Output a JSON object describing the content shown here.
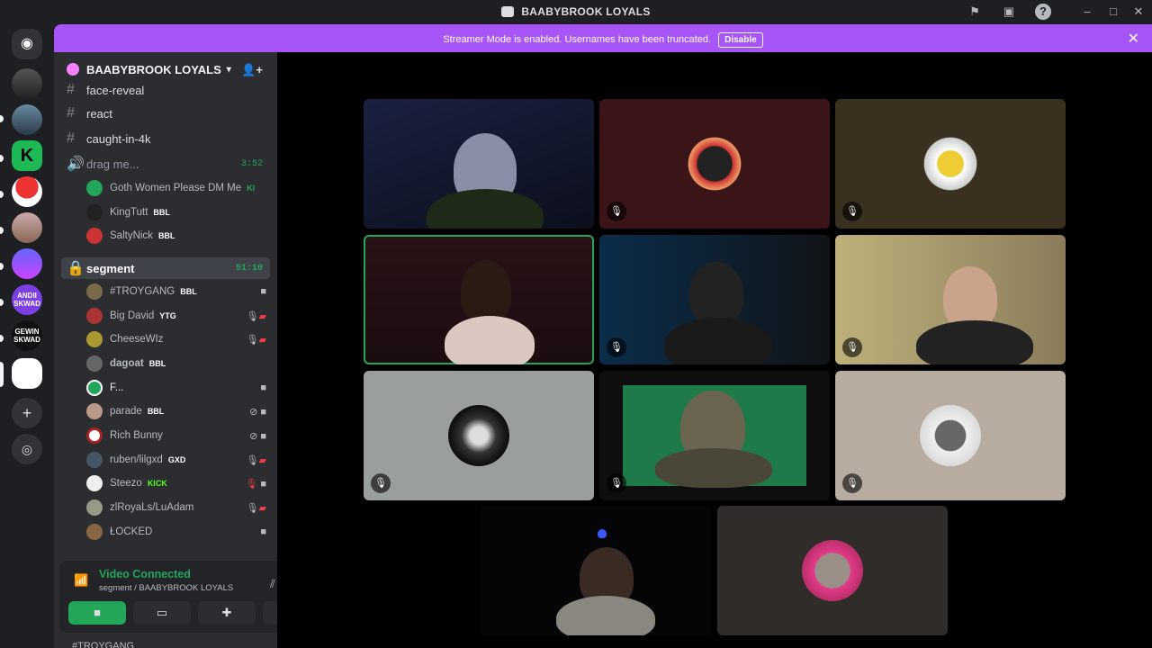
{
  "window": {
    "title": "BAABYBROOK LOYALS"
  },
  "banner": {
    "message": "Streamer Mode is enabled. Usernames have been truncated.",
    "button": "Disable"
  },
  "server": {
    "name": "BAABYBROOK LOYALS"
  },
  "channels": {
    "face_reveal": "face-reveal",
    "react": "react",
    "caught": "caught-in-4k",
    "drag": "drag me...",
    "drag_time": "3:52",
    "segment": "segment",
    "segment_time": "51:10"
  },
  "drag_users": [
    {
      "name": "Goth Women Please DM Me",
      "tag": "KI"
    },
    {
      "name": "KingTutt",
      "tag": "BBL"
    },
    {
      "name": "SaltyNick",
      "tag": "BBL"
    }
  ],
  "segment_users": [
    {
      "name": "#TROYGANG",
      "tag": "BBL"
    },
    {
      "name": "Big David",
      "tag": "YTG"
    },
    {
      "name": "CheeseWIz",
      "tag": ""
    },
    {
      "name": "dagoat",
      "tag": "BBL"
    },
    {
      "name": "F...",
      "tag": ""
    },
    {
      "name": "parade",
      "tag": "BBL"
    },
    {
      "name": "Rich Bunny",
      "tag": ""
    },
    {
      "name": "ruben/lilgxd",
      "tag": "GXD"
    },
    {
      "name": "Steezo",
      "tag": "KICK"
    },
    {
      "name": "zlRoyaLs/LuAdam",
      "tag": ""
    },
    {
      "name": "ŁOCKED",
      "tag": ""
    }
  ],
  "voice": {
    "status": "Video Connected",
    "location": "segment / BAABYBROOK LOYALS"
  },
  "bottom_user": "#TROYGANG",
  "colors": {
    "accent": "#a855f7",
    "green": "#23a55a",
    "red": "#f23f43",
    "blurple": "#5865f2"
  }
}
